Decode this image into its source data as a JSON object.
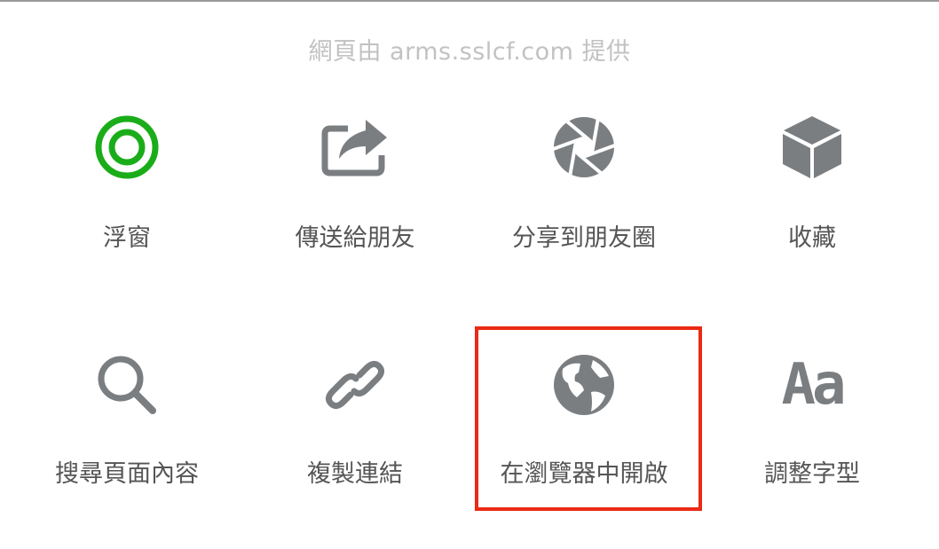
{
  "header": {
    "source_caption": "網頁由 arms.sslcf.com 提供"
  },
  "actions": [
    {
      "label": "浮窗",
      "icon": "floating-window-icon"
    },
    {
      "label": "傳送給朋友",
      "icon": "share-forward-icon"
    },
    {
      "label": "分享到朋友圈",
      "icon": "moments-aperture-icon"
    },
    {
      "label": "收藏",
      "icon": "favorite-cube-icon"
    },
    {
      "label": "搜尋頁面內容",
      "icon": "search-icon"
    },
    {
      "label": "複製連結",
      "icon": "link-icon"
    },
    {
      "label": "在瀏覽器中開啟",
      "icon": "globe-icon"
    },
    {
      "label": "調整字型",
      "icon": "font-size-icon",
      "glyph": "Aa"
    }
  ],
  "colors": {
    "icon_gray": "#7b7e81",
    "floating_green": "#1aad19",
    "highlight_red": "#ea2a14",
    "caption_gray": "#c2c2c2",
    "label_gray": "#555555"
  },
  "highlighted_action": "在瀏覽器中開啟"
}
